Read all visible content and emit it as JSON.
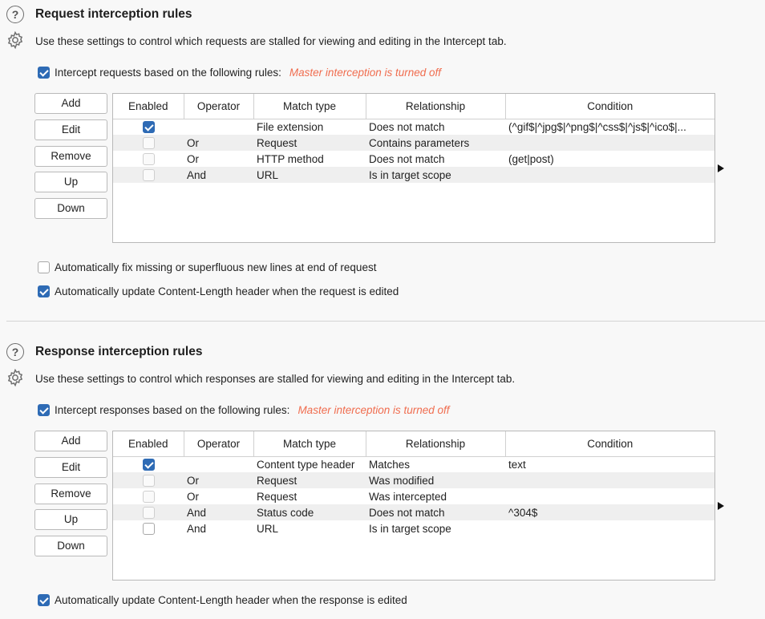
{
  "request": {
    "title": "Request interception rules",
    "description": "Use these settings to control which requests are stalled for viewing and editing in the Intercept tab.",
    "intercept_label": "Intercept requests based on the following rules:",
    "intercept_checked": true,
    "warning": "Master interception is turned off",
    "buttons": {
      "add": "Add",
      "edit": "Edit",
      "remove": "Remove",
      "up": "Up",
      "down": "Down"
    },
    "columns": {
      "enabled": "Enabled",
      "operator": "Operator",
      "match_type": "Match type",
      "relationship": "Relationship",
      "condition": "Condition"
    },
    "rows": [
      {
        "enabled": true,
        "operator": "",
        "match_type": "File extension",
        "relationship": "Does not match",
        "condition": "(^gif$|^jpg$|^png$|^css$|^js$|^ico$|..."
      },
      {
        "enabled": false,
        "operator": "Or",
        "match_type": "Request",
        "relationship": "Contains parameters",
        "condition": ""
      },
      {
        "enabled": false,
        "operator": "Or",
        "match_type": "HTTP method",
        "relationship": "Does not match",
        "condition": "(get|post)"
      },
      {
        "enabled": false,
        "operator": "And",
        "match_type": "URL",
        "relationship": "Is in target scope",
        "condition": ""
      }
    ],
    "opt_fix_newlines": "Automatically fix missing or superfluous new lines at end of request",
    "opt_fix_newlines_checked": false,
    "opt_update_length": "Automatically update Content-Length header when the request is edited",
    "opt_update_length_checked": true
  },
  "response": {
    "title": "Response interception rules",
    "description": "Use these settings to control which responses are stalled for viewing and editing in the Intercept tab.",
    "intercept_label": "Intercept responses based on the following rules:",
    "intercept_checked": true,
    "warning": "Master interception is turned off",
    "buttons": {
      "add": "Add",
      "edit": "Edit",
      "remove": "Remove",
      "up": "Up",
      "down": "Down"
    },
    "columns": {
      "enabled": "Enabled",
      "operator": "Operator",
      "match_type": "Match type",
      "relationship": "Relationship",
      "condition": "Condition"
    },
    "rows": [
      {
        "enabled": true,
        "operator": "",
        "match_type": "Content type header",
        "relationship": "Matches",
        "condition": "text"
      },
      {
        "enabled": false,
        "operator": "Or",
        "match_type": "Request",
        "relationship": "Was modified",
        "condition": ""
      },
      {
        "enabled": false,
        "operator": "Or",
        "match_type": "Request",
        "relationship": "Was intercepted",
        "condition": ""
      },
      {
        "enabled": false,
        "operator": "And",
        "match_type": "Status code",
        "relationship": "Does not match",
        "condition": "^304$"
      },
      {
        "enabled": false,
        "operator": "And",
        "match_type": "URL",
        "relationship": "Is in target scope",
        "condition": ""
      }
    ],
    "opt_update_length": "Automatically update Content-Length header when the response is edited",
    "opt_update_length_checked": true
  },
  "colors": {
    "accent": "#2e6bb5",
    "warning": "#f06d4f"
  }
}
